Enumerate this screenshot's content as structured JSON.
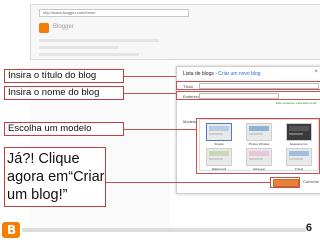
{
  "browser": {
    "url": "http://www.blogger.com/home",
    "brand": "Blogger"
  },
  "dialog": {
    "title_prefix": "Lista de blogs",
    "title_link": "› Criar um novo blog",
    "title_label": "Título",
    "address_label": "Endereço",
    "address_available": "Este endereço está disponível.",
    "template_label": "Modelo",
    "templates": [
      "Simple",
      "Picture Window",
      "Awesome Inc.",
      "Watermark",
      "Ethereal",
      "Travel"
    ],
    "create_button": "Criar blog!",
    "cancel_button": "Cancelar"
  },
  "callouts": {
    "title": "Insira o título do blog",
    "name": "Insira o nome do blog",
    "template": "Escolha um modelo",
    "create": "Já?! Clique agora em“Criar um blog!”"
  },
  "page_number": "6"
}
